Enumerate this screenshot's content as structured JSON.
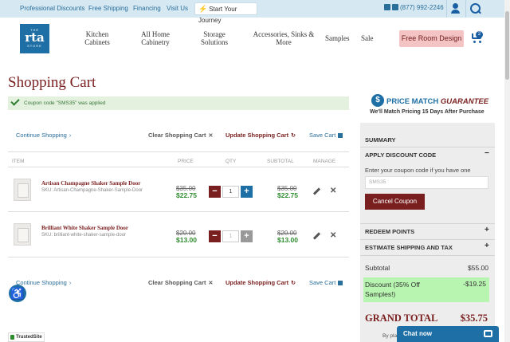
{
  "topbar": {
    "links": [
      "Professional Discounts",
      "Free Shipping",
      "Financing",
      "Visit Us"
    ],
    "journey_label": "Start Your Journey",
    "phone": "(877) 992-2246"
  },
  "logo": {
    "the": "THE",
    "main": "rta",
    "store": "STORE"
  },
  "nav": [
    "Kitchen Cabinets",
    "All Home Cabinetry",
    "Storage Solutions",
    "Accessories, Sinks & More",
    "Samples",
    "Sale"
  ],
  "free_room_label": "Free Room Design",
  "cart_count": "2",
  "page_title": "Shopping Cart",
  "coupon_message": "Coupon code \"SMS35\" was applied",
  "actions": {
    "continue": "Continue Shopping",
    "clear": "Clear Shopping Cart",
    "update": "Update Shopping Cart",
    "save": "Save Cart"
  },
  "columns": [
    "ITEM",
    "PRICE",
    "QTY",
    "SUBTOTAL",
    "MANAGE"
  ],
  "items": [
    {
      "name": "Artisan Champagne Shaker Sample Door",
      "sku": "SKU: Artisan-Champagne-Shaker-Sample-Door",
      "old_price": "$35.00",
      "price": "$22.75",
      "qty": "1",
      "old_subtotal": "$35.00",
      "subtotal": "$22.75"
    },
    {
      "name": "Brilliant White Shaker Sample Door",
      "sku": "SKU: brilliant-white-shaker-sample-door",
      "old_price": "$20.00",
      "price": "$13.00",
      "qty": "1",
      "old_subtotal": "$20.00",
      "subtotal": "$13.00"
    }
  ],
  "price_match": {
    "title_a": "PRICE MATCH",
    "title_b": "GUARANTEE",
    "subtitle": "We'll Match Pricing 15 Days After Purchase"
  },
  "summary": {
    "title": "SUMMARY",
    "discount_section": "APPLY DISCOUNT CODE",
    "coupon_label": "Enter your coupon code if you have one",
    "coupon_value": "SMS35",
    "cancel_label": "Cancel Coupon",
    "redeem_section": "REDEEM POINTS",
    "shipping_section": "ESTIMATE SHIPPING AND TAX",
    "subtotal_label": "Subtotal",
    "subtotal_value": "$55.00",
    "discount_label": "Discount (35% Off Samples!)",
    "discount_value": "-$19.25",
    "grand_label": "GRAND TOTAL",
    "grand_value": "$35.75",
    "by_text": "By pla"
  },
  "chat_label": "Chat now",
  "trusted_label": "TrustedSite"
}
